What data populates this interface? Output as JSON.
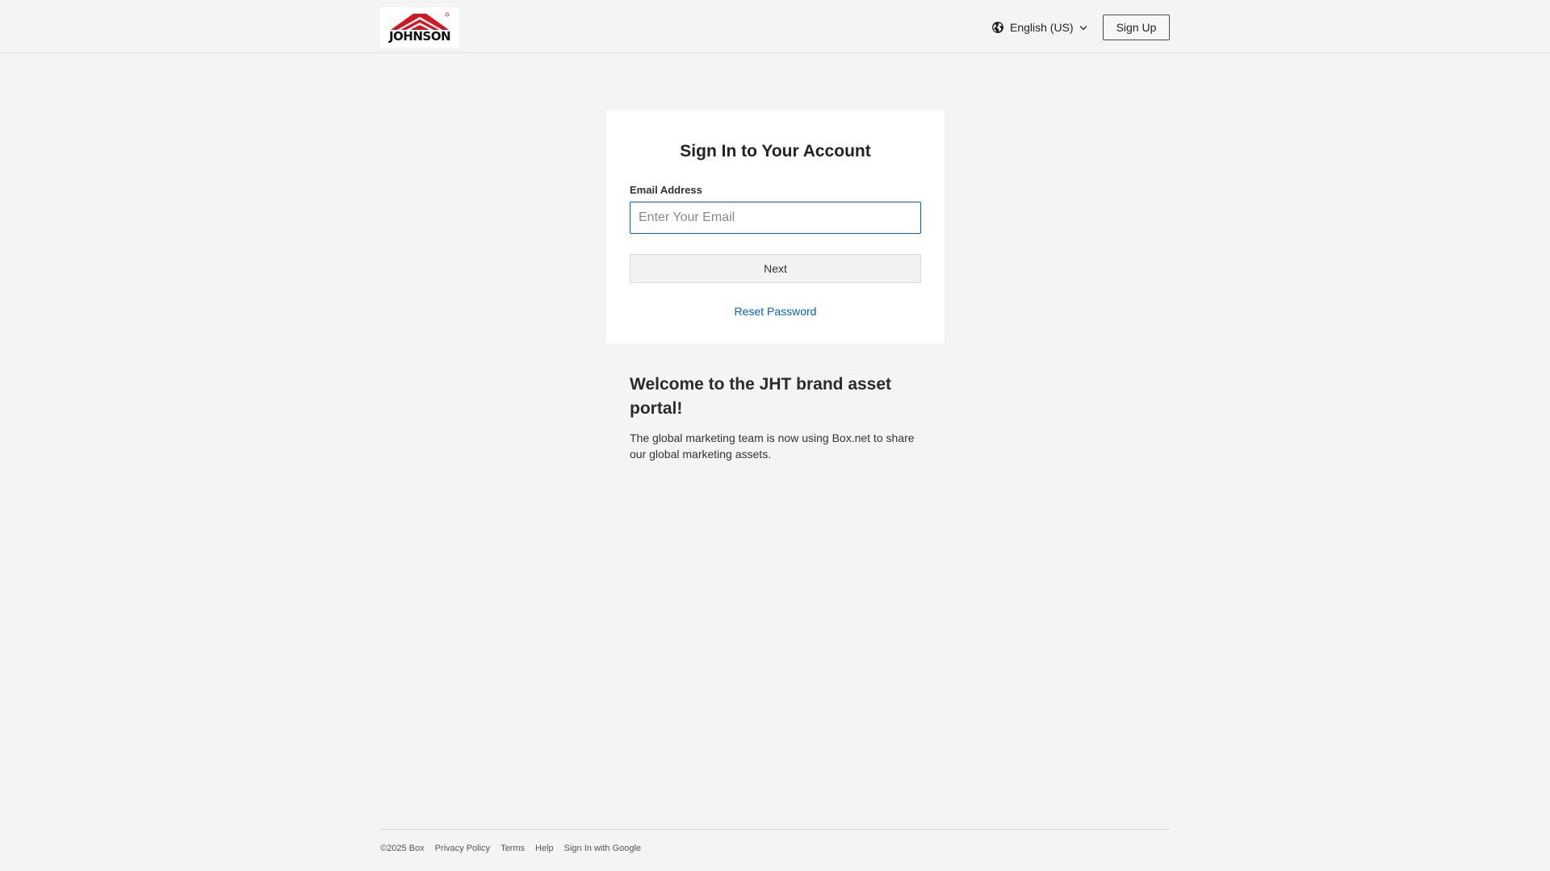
{
  "header": {
    "logo_text": "JOHNSON",
    "language_label": "English (US)",
    "signup_label": "Sign Up"
  },
  "signin": {
    "title": "Sign In to Your Account",
    "email_label": "Email Address",
    "email_placeholder": "Enter Your Email",
    "email_value": "",
    "next_label": "Next",
    "reset_label": "Reset Password"
  },
  "welcome": {
    "title": "Welcome to the JHT brand asset portal!",
    "text": "The global marketing team is now using Box.net to share our global marketing assets."
  },
  "footer": {
    "copyright": "©2025 Box",
    "links": [
      "Privacy Policy",
      "Terms",
      "Help",
      "Sign In with Google"
    ]
  },
  "colors": {
    "brand_red": "#d7141f",
    "link_blue": "#0061d5",
    "page_bg": "#f4f4f4"
  },
  "icons": {
    "language": "globe-icon",
    "language_dropdown": "chevron-down-icon",
    "logo": "johnson-logo"
  }
}
